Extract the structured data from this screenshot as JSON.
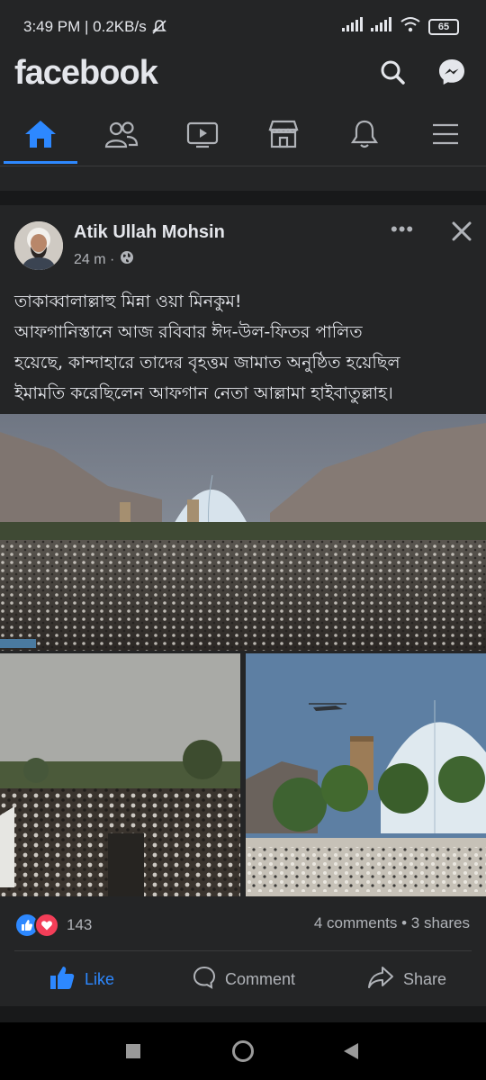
{
  "status_bar": {
    "time": "3:49 PM | 0.2KB/s",
    "battery": "65"
  },
  "app": {
    "logo": "facebook",
    "icons": [
      "search-icon",
      "messenger-icon"
    ],
    "accent_color": "#2d88ff"
  },
  "nav": {
    "items": [
      {
        "name": "home",
        "icon": "home-icon",
        "active": true
      },
      {
        "name": "friends",
        "icon": "friends-icon",
        "active": false
      },
      {
        "name": "watch",
        "icon": "video-icon",
        "active": false
      },
      {
        "name": "marketplace",
        "icon": "store-icon",
        "active": false
      },
      {
        "name": "notifications",
        "icon": "bell-icon",
        "active": false
      },
      {
        "name": "menu",
        "icon": "hamburger-icon",
        "active": false
      }
    ]
  },
  "post": {
    "author": "Atik Ullah Mohsin",
    "time": "24 m ·",
    "privacy_icon": "globe-icon",
    "text_lines": [
      "তাকাব্বালাল্লাহু মিন্না ওয়া মিনকুম!",
      "আফগানিস্তানে আজ রবিবার ঈদ-উল-ফিতর পালিত",
      "হয়েছে, কান্দাহারে তাদের বৃহত্তম জামাত অনুষ্ঠিত হয়েছিল",
      "ইমামতি করেছিলেন আফগান নেতা আল্লামা হাইবাতুল্লাহ।"
    ],
    "reaction_count": "143",
    "engagement": "4 comments • 3 shares",
    "actions": {
      "like": "Like",
      "comment": "Comment",
      "share": "Share"
    }
  }
}
